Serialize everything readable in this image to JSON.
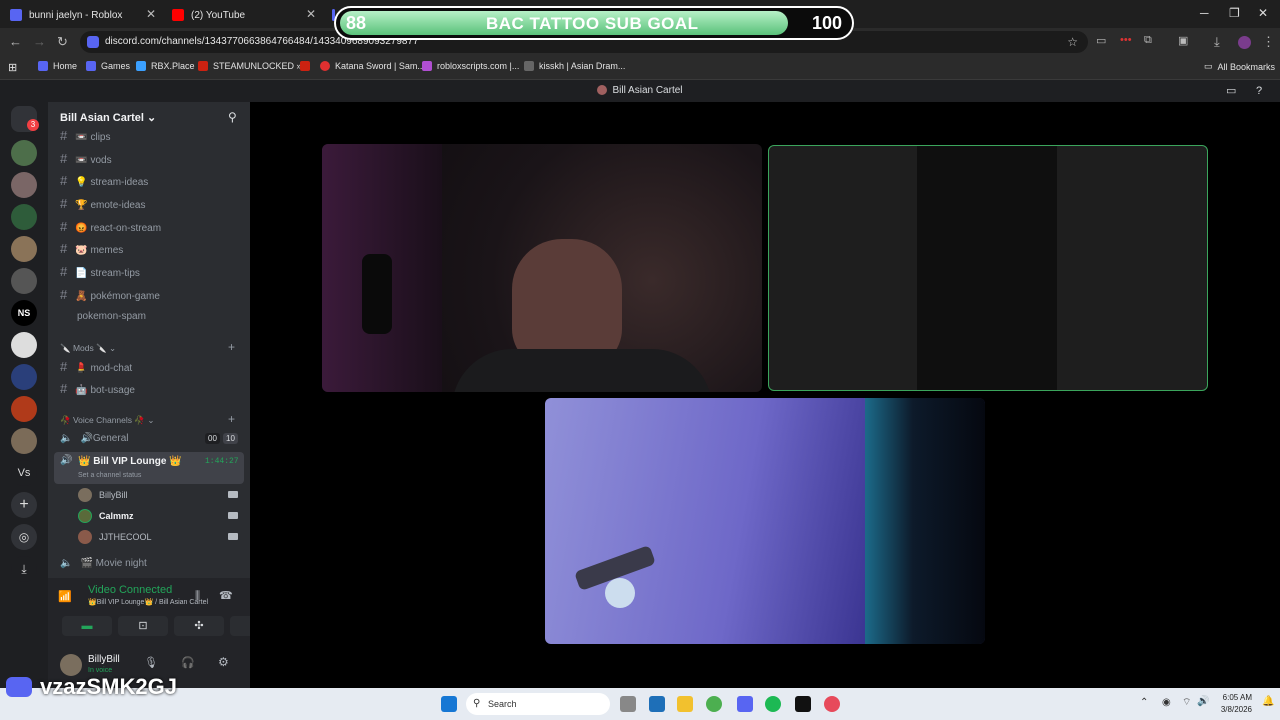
{
  "browser": {
    "tabs": [
      {
        "title": "bunni jaelyn - Roblox"
      },
      {
        "title": "(2) YouTube"
      }
    ],
    "url": "discord.com/channels/1343770663864766484/1433409689093279877",
    "bookmarks": [
      "Home",
      "Games",
      "RBX.Place",
      "STEAMUNLOCKED »...",
      "Katana Sword | Sam...",
      "robloxscripts.com |...",
      "kisskh | Asian Dram..."
    ],
    "all_bookmarks": "All Bookmarks"
  },
  "overlay": {
    "current": "88",
    "title": "BAC TATTOO SUB GOAL",
    "target": "100",
    "progress": 0.88
  },
  "discord": {
    "window_title": "Bill Asian Cartel",
    "notif_badge": "3",
    "server_name": "Bill Asian Cartel",
    "channels": [
      {
        "name": "clips",
        "emoji": "📼"
      },
      {
        "name": "vods",
        "emoji": "📼"
      },
      {
        "name": "stream-ideas",
        "emoji": "💡"
      },
      {
        "name": "emote-ideas",
        "emoji": "🏆"
      },
      {
        "name": "react-on-stream",
        "emoji": "😡"
      },
      {
        "name": "memes",
        "emoji": "🐷"
      },
      {
        "name": "stream-tips",
        "emoji": "📄"
      },
      {
        "name": "pokémon-game",
        "emoji": "🧸"
      },
      {
        "name": "pokemon-spam",
        "emoji": ""
      }
    ],
    "mods_category": "🔪 Mods 🔪",
    "mod_channels": [
      {
        "name": "mod-chat",
        "emoji": "💄"
      },
      {
        "name": "bot-usage",
        "emoji": "🤖"
      }
    ],
    "voice_category": "🥀 Voice Channels 🥀",
    "voice": {
      "general": "🔊General",
      "general_count": "00",
      "general_limit": "10",
      "lounge": "👑 Bill VIP Lounge 👑",
      "lounge_time": "1:44:27",
      "lounge_status": "Set a channel status",
      "users": [
        "BillyBill",
        "Calmmz",
        "JJTHECOOL"
      ],
      "movie": "🎬 Movie night"
    },
    "connection": {
      "status": "Video Connected",
      "where": "👑Bill VIP Lounge👑 / Bill Asian Cartel"
    },
    "user": {
      "name": "BillyBill",
      "state": "In voice"
    }
  },
  "watermark": "vzazSMK2GJ",
  "taskbar": {
    "search": "Search",
    "time": "6:05 AM",
    "date": "3/8/2026"
  },
  "colors": {
    "accent": "#5865f2",
    "green": "#23a55a"
  }
}
